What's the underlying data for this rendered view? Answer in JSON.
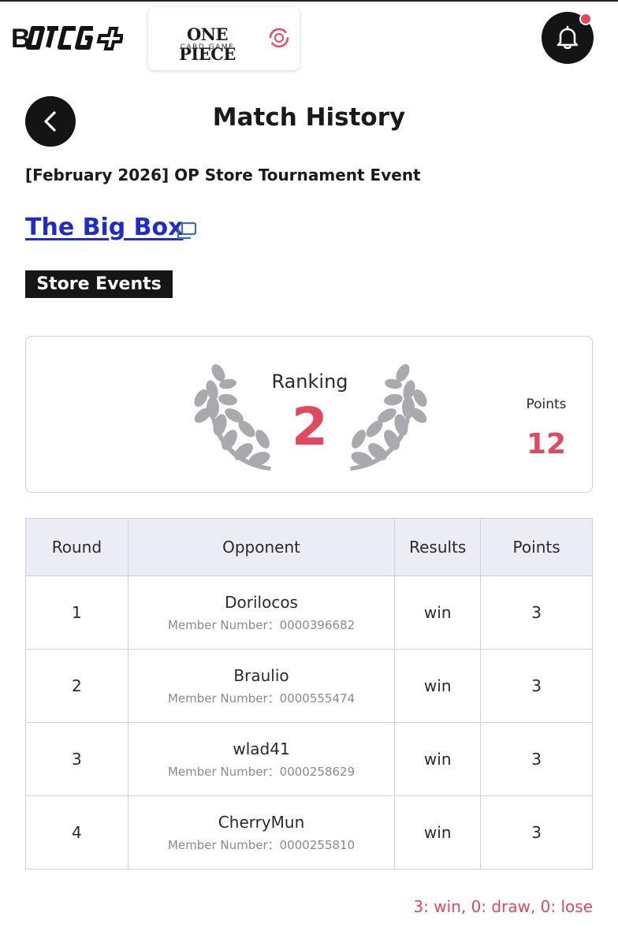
{
  "header": {
    "brand_name": "B-TCG+",
    "game_title": "ONE PIECE",
    "game_subtitle": "CARD GAME"
  },
  "page": {
    "title": "Match History",
    "event_name": "[February 2026] OP Store Tournament Event",
    "store_name": "The Big Box",
    "event_tag": "Store Events"
  },
  "ranking": {
    "label": "Ranking",
    "value": "2",
    "points_label": "Points",
    "points_value": "12"
  },
  "table": {
    "headers": [
      "Round",
      "Opponent",
      "Results",
      "Points"
    ],
    "member_prefix": "Member Number：",
    "rows": [
      {
        "round": "1",
        "opponent": "Dorilocos",
        "member": "Member Number：0000396682",
        "result": "win",
        "points": "3"
      },
      {
        "round": "2",
        "opponent": "Braulio",
        "member": "Member Number：0000555474",
        "result": "win",
        "points": "3"
      },
      {
        "round": "3",
        "opponent": "wlad41",
        "member": "Member Number：0000258629",
        "result": "win",
        "points": "3"
      },
      {
        "round": "4",
        "opponent": "CherryMun",
        "member": "Member Number：0000255810",
        "result": "win",
        "points": "3"
      }
    ]
  },
  "summary": "3: win, 0: draw, 0: lose",
  "colors": {
    "accent": "#e5485e",
    "link": "#1f2bd1",
    "dark": "#141414",
    "table_header_bg": "#ececf6"
  },
  "icons": [
    "brand-logo",
    "game-switch-icon",
    "bell-icon",
    "back-arrow-icon",
    "external-link-icon",
    "laurel-icon"
  ]
}
